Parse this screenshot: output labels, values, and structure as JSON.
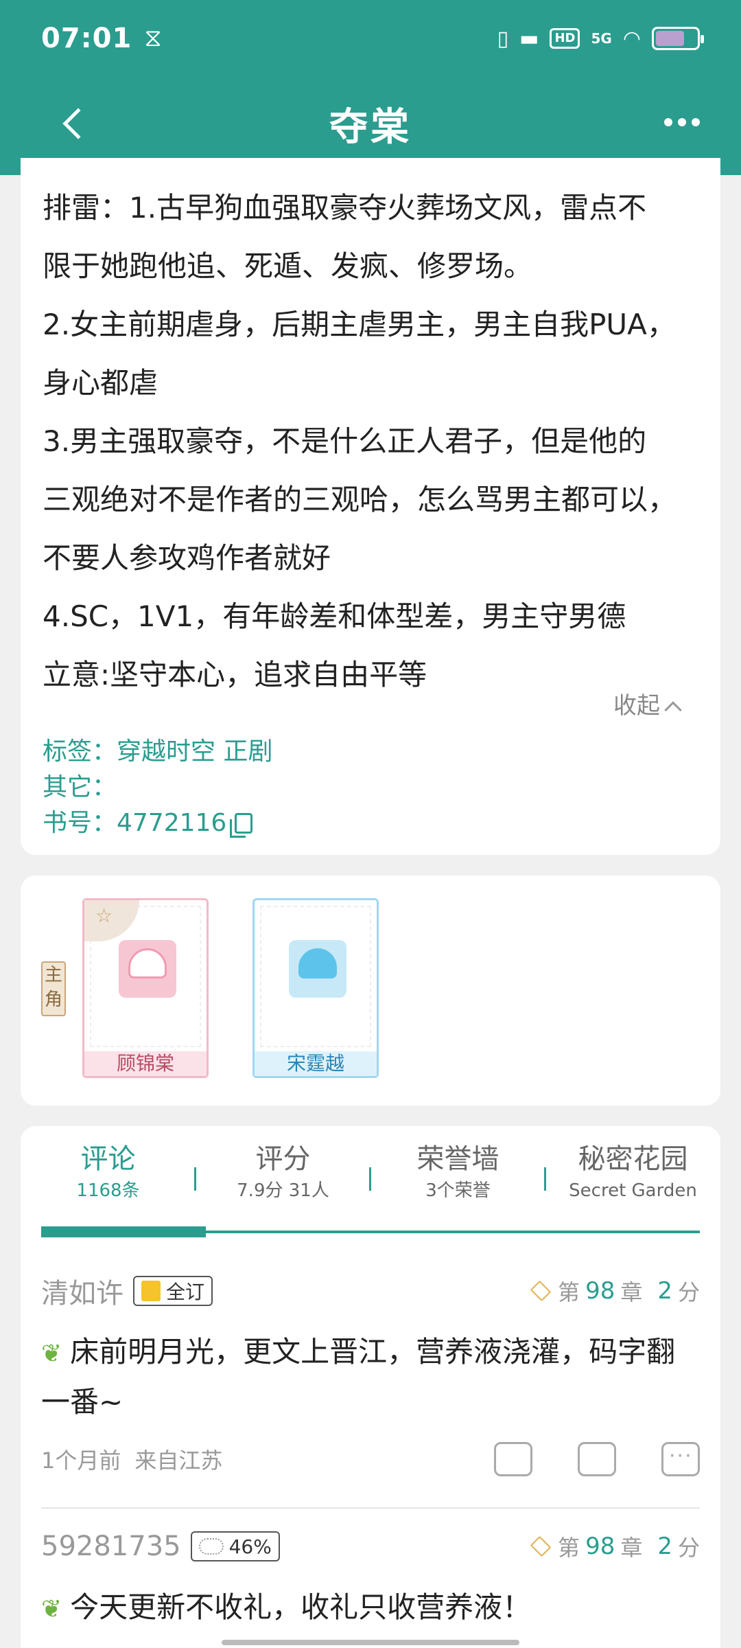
{
  "status_bar": {
    "time": "07:01",
    "hd": "HD",
    "signal": "5G"
  },
  "header": {
    "title": "夺棠"
  },
  "intro": {
    "lines": [
      "排雷：1.古早狗血强取豪夺火葬场文风，雷点不",
      "限于她跑他追、死遁、发疯、修罗场。",
      "2.女主前期虐身，后期主虐男主，男主自我PUA，",
      "身心都虐",
      "3.男主强取豪夺，不是什么正人君子，但是他的",
      "三观绝对不是作者的三观哈，怎么骂男主都可以，",
      "不要人参攻鸡作者就好",
      "4.SC，1V1，有年龄差和体型差，男主守男德",
      "立意:坚守本心，追求自由平等"
    ],
    "collapse_label": "收起",
    "tags_line": "标签：穿越时空 正剧",
    "other_line": "其它：",
    "book_line": "书号：4772116"
  },
  "characters": {
    "role_label": "主角",
    "items": [
      {
        "name": "顾锦棠"
      },
      {
        "name": "宋霆越"
      }
    ]
  },
  "tabs": [
    {
      "label": "评论",
      "sub": "1168条"
    },
    {
      "label": "评分",
      "sub": "7.9分 31人"
    },
    {
      "label": "荣誉墙",
      "sub": "3个荣誉"
    },
    {
      "label": "秘密花园",
      "sub": "Secret Garden"
    }
  ],
  "comments": [
    {
      "user": "清如许",
      "badge": "全订",
      "chapter_prefix": "第",
      "chapter_num": "98",
      "chapter_suffix": "章",
      "score_num": "2",
      "score_suffix": "分",
      "text": "床前明月光，更文上晋江，营养液浇灌，码字翻一番~",
      "time": "1个月前",
      "location": "来自江苏"
    },
    {
      "user": "59281735",
      "badge": "46%",
      "chapter_prefix": "第",
      "chapter_num": "98",
      "chapter_suffix": "章",
      "score_num": "2",
      "score_suffix": "分",
      "text": "今天更新不收礼，收礼只收营养液！"
    }
  ],
  "colors": {
    "accent": "#2a9d8f",
    "background": "#f0f0f0"
  }
}
